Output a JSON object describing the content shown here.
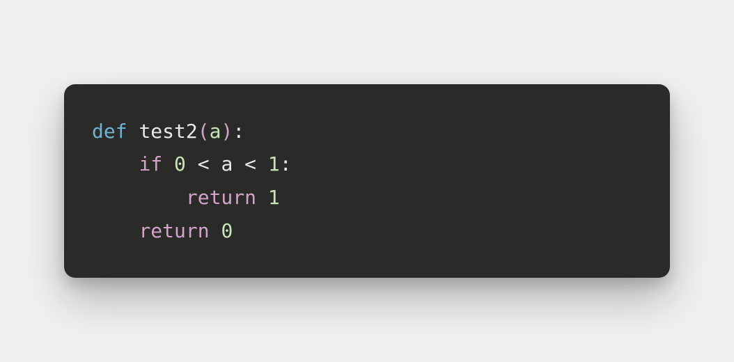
{
  "code": {
    "language": "python",
    "lines": [
      {
        "tokens": [
          {
            "text": "def ",
            "class": "tok-keyword"
          },
          {
            "text": "test2",
            "class": "tok-funcname"
          },
          {
            "text": "(",
            "class": "tok-paren"
          },
          {
            "text": "a",
            "class": "tok-param"
          },
          {
            "text": ")",
            "class": "tok-paren"
          },
          {
            "text": ":",
            "class": "tok-punct"
          }
        ]
      },
      {
        "indent": "    ",
        "tokens": [
          {
            "text": "if ",
            "class": "tok-control"
          },
          {
            "text": "0",
            "class": "tok-number"
          },
          {
            "text": " < ",
            "class": "tok-op"
          },
          {
            "text": "a",
            "class": "tok-funcname"
          },
          {
            "text": " < ",
            "class": "tok-op"
          },
          {
            "text": "1",
            "class": "tok-number"
          },
          {
            "text": ":",
            "class": "tok-punct"
          }
        ]
      },
      {
        "indent": "        ",
        "tokens": [
          {
            "text": "return ",
            "class": "tok-control"
          },
          {
            "text": "1",
            "class": "tok-number"
          }
        ]
      },
      {
        "indent": "    ",
        "tokens": [
          {
            "text": "return ",
            "class": "tok-control"
          },
          {
            "text": "0",
            "class": "tok-number"
          }
        ]
      }
    ]
  }
}
